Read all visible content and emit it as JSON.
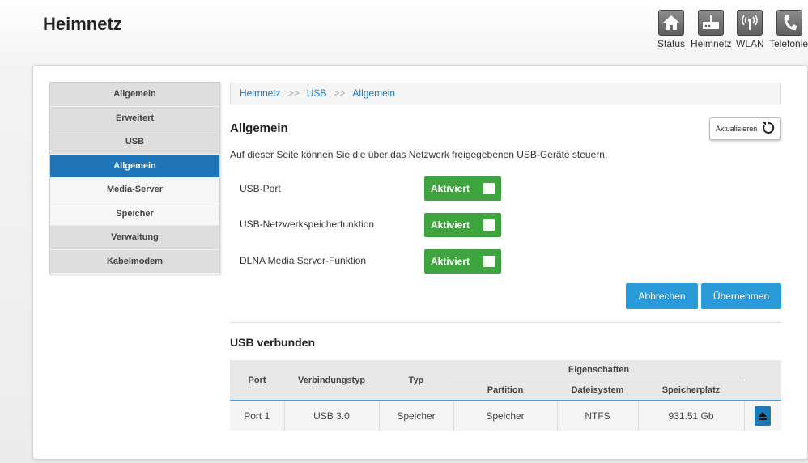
{
  "app": {
    "title": "Heimnetz"
  },
  "topnav": [
    {
      "label": "Status",
      "icon": "home-icon"
    },
    {
      "label": "Heimnetz",
      "icon": "router-icon"
    },
    {
      "label": "WLAN",
      "icon": "wifi-icon"
    },
    {
      "label": "Telefonie",
      "icon": "phone-icon"
    }
  ],
  "sidebar": {
    "items": [
      {
        "label": "Allgemein"
      },
      {
        "label": "Erweitert"
      },
      {
        "label": "USB"
      },
      {
        "label": "Allgemein",
        "active": true
      },
      {
        "label": "Media-Server"
      },
      {
        "label": "Speicher"
      },
      {
        "label": "Verwaltung"
      },
      {
        "label": "Kabelmodem"
      }
    ]
  },
  "breadcrumb": {
    "items": [
      "Heimnetz",
      "USB",
      "Allgemein"
    ],
    "separator": ">>"
  },
  "section": {
    "title": "Allgemein",
    "description": "Auf dieser Seite können Sie die über das Netzwerk freigegebenen USB-Geräte steuern.",
    "refresh_label": "Aktualisieren"
  },
  "settings": [
    {
      "label": "USB-Port",
      "state": "Aktiviert"
    },
    {
      "label": "USB-Netzwerkspeicherfunktion",
      "state": "Aktiviert"
    },
    {
      "label": "DLNA Media Server-Funktion",
      "state": "Aktiviert"
    }
  ],
  "actions": {
    "cancel_label": "Abbrechen",
    "apply_label": "Übernehmen"
  },
  "usb": {
    "title": "USB verbunden",
    "headers": {
      "port": "Port",
      "connection_type": "Verbindungstyp",
      "type": "Typ",
      "properties": "Eigenschaften",
      "partition": "Partition",
      "filesystem": "Dateisystem",
      "storage": "Speicherplatz"
    },
    "rows": [
      {
        "port": "Port 1",
        "connection_type": "USB 3.0",
        "type": "Speicher",
        "partition": "Speicher",
        "filesystem": "NTFS",
        "storage": "931.51 Gb"
      }
    ]
  },
  "colors": {
    "accent": "#1f75b8",
    "toggle_on": "#3fa43f",
    "button": "#2a9ad8"
  }
}
